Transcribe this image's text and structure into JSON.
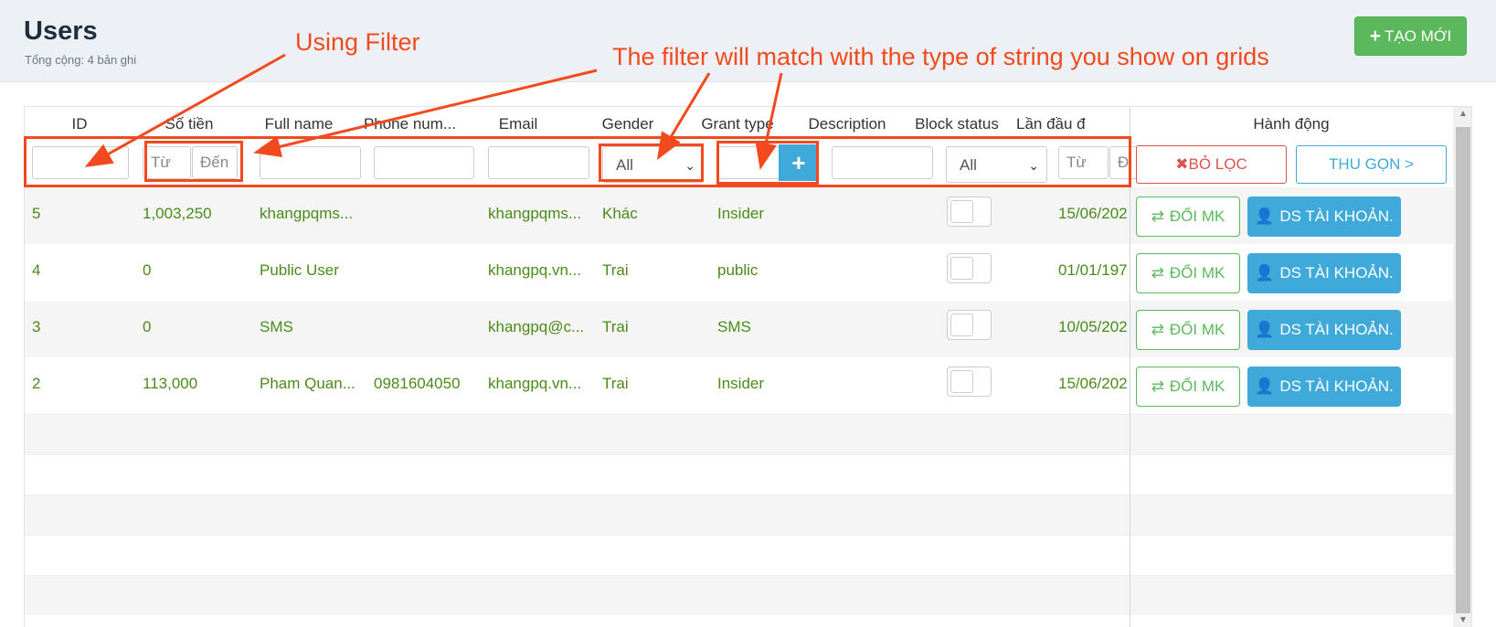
{
  "header": {
    "title": "Users",
    "subtitle": "Tổng cộng: 4 bản ghi",
    "create_label": "TẠO MỚI"
  },
  "columns": [
    "ID",
    "Số tiền",
    "Full name",
    "Phone num...",
    "Email",
    "Gender",
    "Grant type",
    "Description",
    "Block status",
    "Lần đầu đ",
    "Hành động"
  ],
  "filters": {
    "amount_from_placeholder": "Từ",
    "amount_to_placeholder": "Đến",
    "gender_selected": "All",
    "block_status_selected": "All",
    "first_from_placeholder": "Từ",
    "first_to_placeholder": "Đ",
    "clear_label": "BỎ LỌC",
    "collapse_label": "THU GỌN >"
  },
  "rows": [
    {
      "id": "5",
      "amount": "1,003,250",
      "full_name": "khangpqms...",
      "phone": "",
      "email": "khangpqms...",
      "gender": "Khác",
      "grant_type": "Insider",
      "description": "",
      "first": "15/06/202"
    },
    {
      "id": "4",
      "amount": "0",
      "full_name": "Public User",
      "phone": "",
      "email": "khangpq.vn...",
      "gender": "Trai",
      "grant_type": "public",
      "description": "",
      "first": "01/01/197"
    },
    {
      "id": "3",
      "amount": "0",
      "full_name": "SMS",
      "phone": "",
      "email": "khangpq@c...",
      "gender": "Trai",
      "grant_type": "SMS",
      "description": "",
      "first": "10/05/202"
    },
    {
      "id": "2",
      "amount": "113,000",
      "full_name": "Pham Quan...",
      "phone": "0981604050",
      "email": "khangpq.vn...",
      "gender": "Trai",
      "grant_type": "Insider",
      "description": "",
      "first": "15/06/202"
    }
  ],
  "row_actions": {
    "change_password_label": "ĐỔI MK",
    "accounts_label": "DS TÀI KHOẢN."
  },
  "annotations": {
    "using_filter": "Using Filter",
    "filter_match": "The filter will match with the type of string you show on grids",
    "color": "#f24a1e"
  },
  "colors": {
    "accent_green": "#5cb85c",
    "accent_blue": "#3fa9d9",
    "danger_red": "#d9534f",
    "data_text": "#4a8a1a"
  }
}
